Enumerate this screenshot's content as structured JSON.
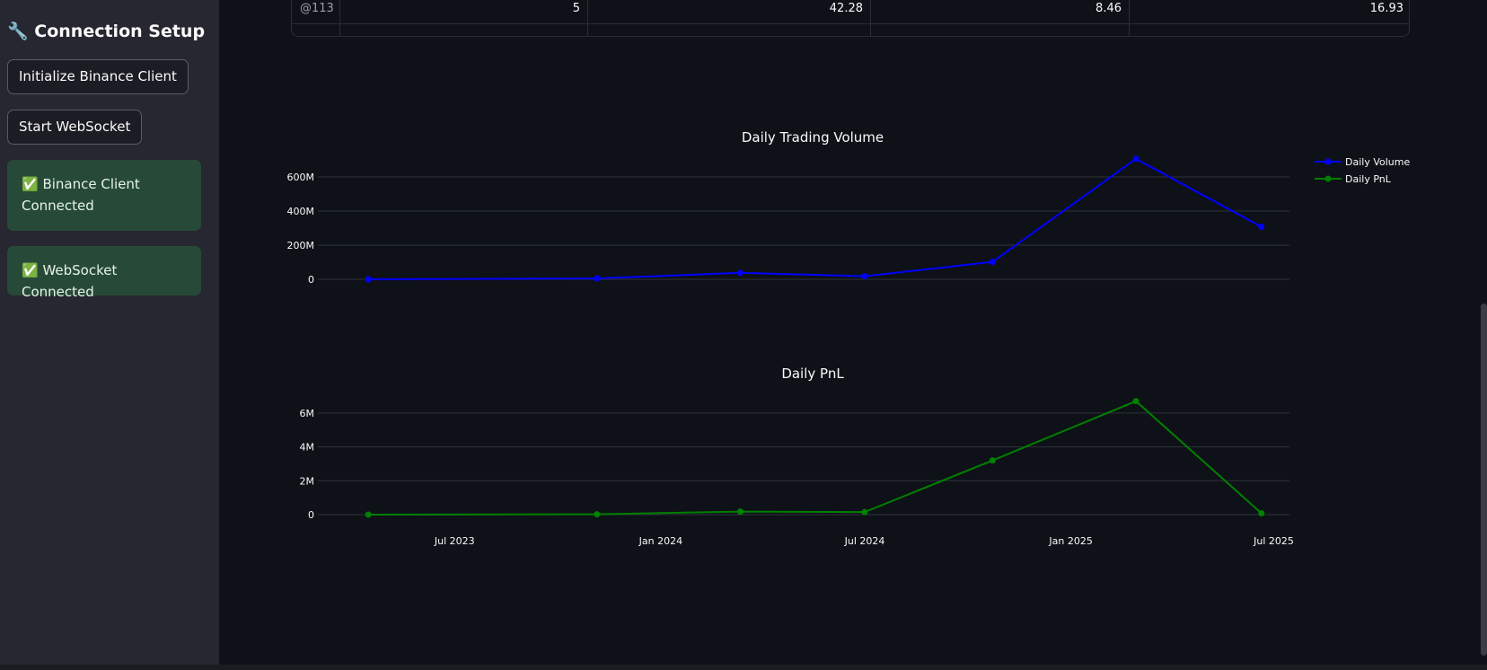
{
  "sidebar": {
    "title": "🔧 Connection Setup",
    "buttons": {
      "init_client": "Initialize Binance Client",
      "start_ws": "Start WebSocket"
    },
    "alerts": {
      "client": "✅ Binance Client Connected",
      "ws": "✅ WebSocket Connected"
    }
  },
  "table": {
    "row": [
      "@113",
      "5",
      "42.28",
      "8.46",
      "16.93"
    ]
  },
  "colors": {
    "volume": "#0000ff",
    "pnl": "#008000",
    "success_bg": "#274a38",
    "sidebar_bg": "#262730",
    "page_bg": "#0e1117"
  },
  "chart_data": [
    {
      "type": "line",
      "title": "Daily Trading Volume",
      "series": [
        {
          "name": "Daily Volume",
          "x": [
            "2023-04-15",
            "2023-11-05",
            "2024-03-12",
            "2024-07-01",
            "2024-10-23",
            "2025-02-28",
            "2025-06-20"
          ],
          "values": [
            0,
            5000000,
            38000000,
            18000000,
            102000000,
            706000000,
            308000000
          ]
        }
      ],
      "xlim": [
        "2023-03-01",
        "2025-07-15"
      ],
      "ylim": [
        0,
        700000000
      ],
      "yticks": [
        "0",
        "200M",
        "400M",
        "600M"
      ],
      "grid": true
    },
    {
      "type": "line",
      "title": "Daily PnL",
      "series": [
        {
          "name": "Daily PnL",
          "x": [
            "2023-04-15",
            "2023-11-05",
            "2024-03-12",
            "2024-07-01",
            "2024-10-23",
            "2025-02-28",
            "2025-06-20"
          ],
          "values": [
            0,
            20000,
            180000,
            150000,
            3200000,
            6700000,
            80000
          ]
        }
      ],
      "xlim": [
        "2023-03-01",
        "2025-07-15"
      ],
      "ylim": [
        0,
        7000000
      ],
      "yticks": [
        "0",
        "2M",
        "4M",
        "6M"
      ],
      "xticks": [
        "Jul 2023",
        "Jan 2024",
        "Jul 2024",
        "Jan 2025",
        "Jul 2025"
      ],
      "grid": true
    }
  ],
  "legend": {
    "placement": "top-right",
    "entries": [
      "Daily Volume",
      "Daily PnL"
    ]
  }
}
